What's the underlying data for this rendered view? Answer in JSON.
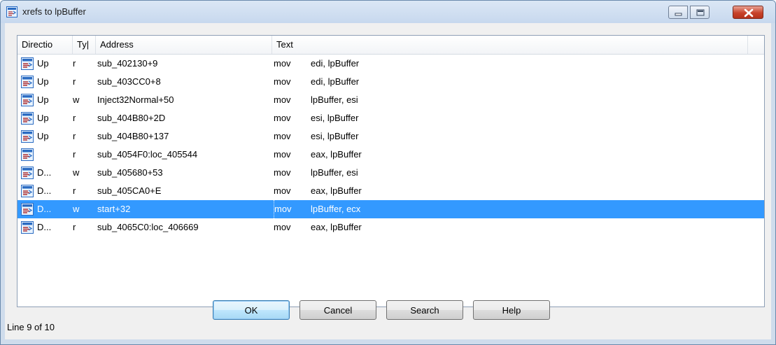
{
  "window": {
    "title": "xrefs to lpBuffer"
  },
  "columns": {
    "direction": "Directio",
    "type": "Ty|",
    "address": "Address",
    "text": "Text"
  },
  "rows": [
    {
      "direction": "Up",
      "type": "r",
      "address": "sub_402130+9",
      "mnemonic": "mov",
      "operands": "edi, lpBuffer"
    },
    {
      "direction": "Up",
      "type": "r",
      "address": "sub_403CC0+8",
      "mnemonic": "mov",
      "operands": "edi, lpBuffer"
    },
    {
      "direction": "Up",
      "type": "w",
      "address": "Inject32Normal+50",
      "mnemonic": "mov",
      "operands": "lpBuffer, esi"
    },
    {
      "direction": "Up",
      "type": "r",
      "address": "sub_404B80+2D",
      "mnemonic": "mov",
      "operands": "esi, lpBuffer"
    },
    {
      "direction": "Up",
      "type": "r",
      "address": "sub_404B80+137",
      "mnemonic": "mov",
      "operands": "esi, lpBuffer"
    },
    {
      "direction": "",
      "type": "r",
      "address": "sub_4054F0:loc_405544",
      "mnemonic": "mov",
      "operands": "eax, lpBuffer"
    },
    {
      "direction": "D...",
      "type": "w",
      "address": "sub_405680+53",
      "mnemonic": "mov",
      "operands": "lpBuffer, esi"
    },
    {
      "direction": "D...",
      "type": "r",
      "address": "sub_405CA0+E",
      "mnemonic": "mov",
      "operands": "eax, lpBuffer"
    },
    {
      "direction": "D...",
      "type": "w",
      "address": "start+32",
      "mnemonic": "mov",
      "operands": "lpBuffer, ecx"
    },
    {
      "direction": "D...",
      "type": "r",
      "address": "sub_4065C0:loc_406669",
      "mnemonic": "mov",
      "operands": "eax, lpBuffer"
    }
  ],
  "selected_row": 8,
  "buttons": {
    "ok": "OK",
    "cancel": "Cancel",
    "search": "Search",
    "help": "Help"
  },
  "status": "Line 9 of 10",
  "icons": {
    "window_icon": "xref-list-icon",
    "row_icon": "xref-list-icon"
  },
  "colors": {
    "selection": "#3399ff",
    "close_button": "#c8432b"
  }
}
